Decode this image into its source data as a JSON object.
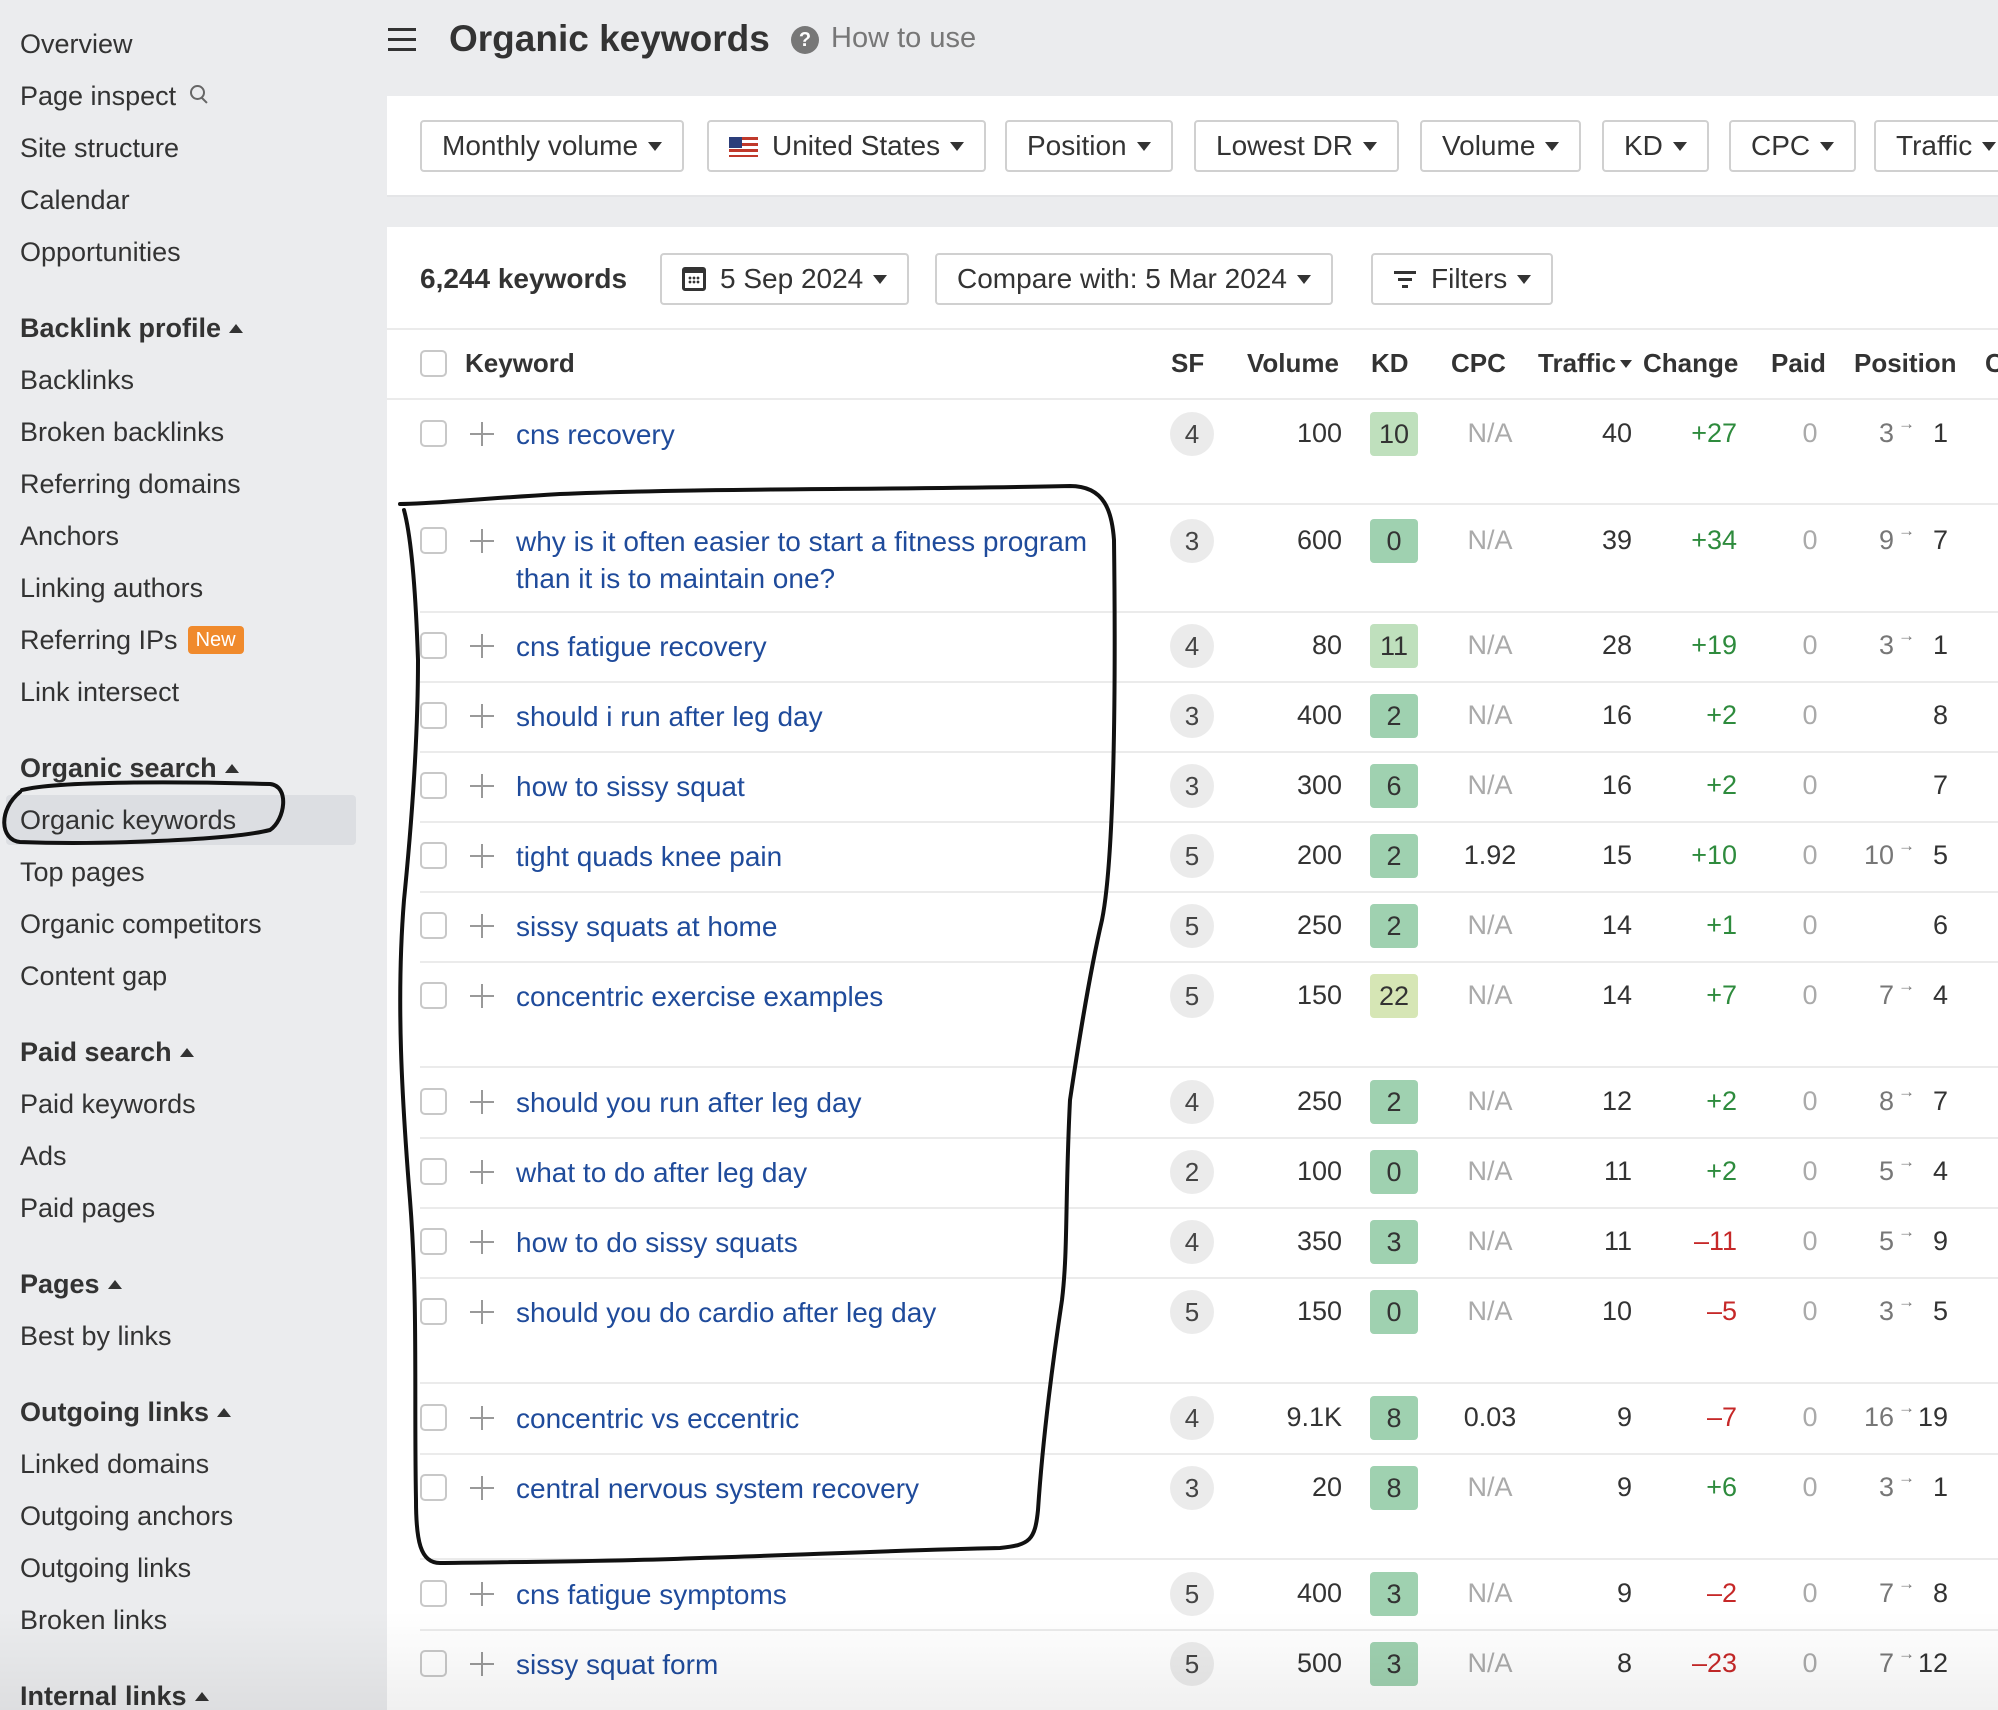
{
  "sidebar": {
    "items": [
      {
        "label": "Overview"
      },
      {
        "label": "Page inspect",
        "icon": "search-icon"
      },
      {
        "label": "Site structure"
      },
      {
        "label": "Calendar"
      },
      {
        "label": "Opportunities"
      }
    ],
    "sections": [
      {
        "title": "Backlink profile",
        "items": [
          "Backlinks",
          "Broken backlinks",
          "Referring domains",
          "Anchors",
          "Linking authors",
          "Referring IPs",
          "Link intersect"
        ],
        "badge": {
          "item": "Referring IPs",
          "label": "New",
          "color": "#f08a2c"
        }
      },
      {
        "title": "Organic search",
        "items": [
          "Organic keywords",
          "Top pages",
          "Organic competitors",
          "Content gap"
        ],
        "active": "Organic keywords"
      },
      {
        "title": "Paid search",
        "items": [
          "Paid keywords",
          "Ads",
          "Paid pages"
        ]
      },
      {
        "title": "Pages",
        "items": [
          "Best by links"
        ]
      },
      {
        "title": "Outgoing links",
        "items": [
          "Linked domains",
          "Outgoing anchors",
          "Outgoing links",
          "Broken links"
        ]
      },
      {
        "title": "Internal links",
        "items": []
      }
    ]
  },
  "header": {
    "title": "Organic keywords",
    "help_label": "How to use",
    "help_icon": "?"
  },
  "filters": {
    "monthly_volume": "Monthly volume",
    "country": "United States",
    "position": "Position",
    "lowest_dr": "Lowest DR",
    "volume": "Volume",
    "kd": "KD",
    "cpc": "CPC",
    "traffic": "Traffic"
  },
  "toolbar": {
    "count": "6,244 keywords",
    "date": "5 Sep 2024",
    "compare": "Compare with: 5 Mar 2024",
    "filters": "Filters"
  },
  "table": {
    "columns": {
      "keyword": "Keyword",
      "sf": "SF",
      "volume": "Volume",
      "kd": "KD",
      "cpc": "CPC",
      "traffic": "Traffic",
      "change": "Change",
      "paid": "Paid",
      "position": "Position",
      "extra": "C"
    },
    "sorted_by": "Traffic",
    "colors": {
      "kd_easy": "#9fd1b0",
      "kd_light": "#bfe0bd",
      "kd_medium": "#d6e6b5",
      "positive": "#2e8b3d",
      "negative": "#c62828",
      "link": "#1f4b9b"
    },
    "rows": [
      {
        "keyword": "cns recovery",
        "sf": "4",
        "volume": "100",
        "kd": "10",
        "cpc": "N/A",
        "traffic": "40",
        "change": "+27",
        "paid": "0",
        "pos_from": "3",
        "pos_to": "1"
      },
      {
        "keyword": "why is it often easier to start a fitness program than it is to maintain one?",
        "sf": "3",
        "volume": "600",
        "kd": "0",
        "cpc": "N/A",
        "traffic": "39",
        "change": "+34",
        "paid": "0",
        "pos_from": "9",
        "pos_to": "7"
      },
      {
        "keyword": "cns fatigue recovery",
        "sf": "4",
        "volume": "80",
        "kd": "11",
        "cpc": "N/A",
        "traffic": "28",
        "change": "+19",
        "paid": "0",
        "pos_from": "3",
        "pos_to": "1"
      },
      {
        "keyword": "should i run after leg day",
        "sf": "3",
        "volume": "400",
        "kd": "2",
        "cpc": "N/A",
        "traffic": "16",
        "change": "+2",
        "paid": "0",
        "pos_from": "",
        "pos_to": "8"
      },
      {
        "keyword": "how to sissy squat",
        "sf": "3",
        "volume": "300",
        "kd": "6",
        "cpc": "N/A",
        "traffic": "16",
        "change": "+2",
        "paid": "0",
        "pos_from": "",
        "pos_to": "7"
      },
      {
        "keyword": "tight quads knee pain",
        "sf": "5",
        "volume": "200",
        "kd": "2",
        "cpc": "1.92",
        "traffic": "15",
        "change": "+10",
        "paid": "0",
        "pos_from": "10",
        "pos_to": "5"
      },
      {
        "keyword": "sissy squats at home",
        "sf": "5",
        "volume": "250",
        "kd": "2",
        "cpc": "N/A",
        "traffic": "14",
        "change": "+1",
        "paid": "0",
        "pos_from": "",
        "pos_to": "6"
      },
      {
        "keyword": "concentric exercise examples",
        "sf": "5",
        "volume": "150",
        "kd": "22",
        "cpc": "N/A",
        "traffic": "14",
        "change": "+7",
        "paid": "0",
        "pos_from": "7",
        "pos_to": "4"
      },
      {
        "keyword": "should you run after leg day",
        "sf": "4",
        "volume": "250",
        "kd": "2",
        "cpc": "N/A",
        "traffic": "12",
        "change": "+2",
        "paid": "0",
        "pos_from": "8",
        "pos_to": "7"
      },
      {
        "keyword": "what to do after leg day",
        "sf": "2",
        "volume": "100",
        "kd": "0",
        "cpc": "N/A",
        "traffic": "11",
        "change": "+2",
        "paid": "0",
        "pos_from": "5",
        "pos_to": "4"
      },
      {
        "keyword": "how to do sissy squats",
        "sf": "4",
        "volume": "350",
        "kd": "3",
        "cpc": "N/A",
        "traffic": "11",
        "change": "–11",
        "paid": "0",
        "pos_from": "5",
        "pos_to": "9"
      },
      {
        "keyword": "should you do cardio after leg day",
        "sf": "5",
        "volume": "150",
        "kd": "0",
        "cpc": "N/A",
        "traffic": "10",
        "change": "–5",
        "paid": "0",
        "pos_from": "3",
        "pos_to": "5"
      },
      {
        "keyword": "concentric vs eccentric",
        "sf": "4",
        "volume": "9.1K",
        "kd": "8",
        "cpc": "0.03",
        "traffic": "9",
        "change": "–7",
        "paid": "0",
        "pos_from": "16",
        "pos_to": "19"
      },
      {
        "keyword": "central nervous system recovery",
        "sf": "3",
        "volume": "20",
        "kd": "8",
        "cpc": "N/A",
        "traffic": "9",
        "change": "+6",
        "paid": "0",
        "pos_from": "3",
        "pos_to": "1"
      },
      {
        "keyword": "cns fatigue symptoms",
        "sf": "5",
        "volume": "400",
        "kd": "3",
        "cpc": "N/A",
        "traffic": "9",
        "change": "–2",
        "paid": "0",
        "pos_from": "7",
        "pos_to": "8"
      },
      {
        "keyword": "sissy squat form",
        "sf": "5",
        "volume": "500",
        "kd": "3",
        "cpc": "N/A",
        "traffic": "8",
        "change": "–23",
        "paid": "0",
        "pos_from": "7",
        "pos_to": "12"
      }
    ]
  }
}
